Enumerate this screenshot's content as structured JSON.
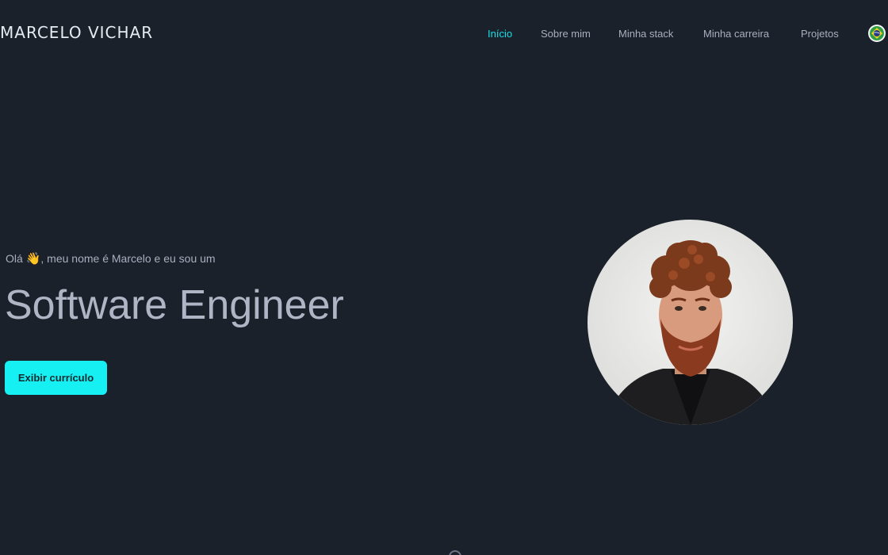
{
  "header": {
    "brand": "MARCELO VICHAR",
    "nav": [
      {
        "label": "Início",
        "active": true
      },
      {
        "label": "Sobre mim"
      },
      {
        "label": "Minha stack"
      },
      {
        "label": "Minha carreira"
      },
      {
        "label": "Projetos"
      }
    ],
    "language_icon": "brazil-flag-icon"
  },
  "hero": {
    "greeting_prefix": "Olá ",
    "greeting_emoji": "👋",
    "greeting_suffix": ", meu nome é Marcelo e eu sou um",
    "headline": "Software Engineer",
    "cta_label": "Exibir currículo"
  },
  "colors": {
    "background": "#1b212a",
    "accent": "#17f0f2",
    "nav_active": "#16e0ea",
    "text_muted": "#a7b0bf"
  }
}
